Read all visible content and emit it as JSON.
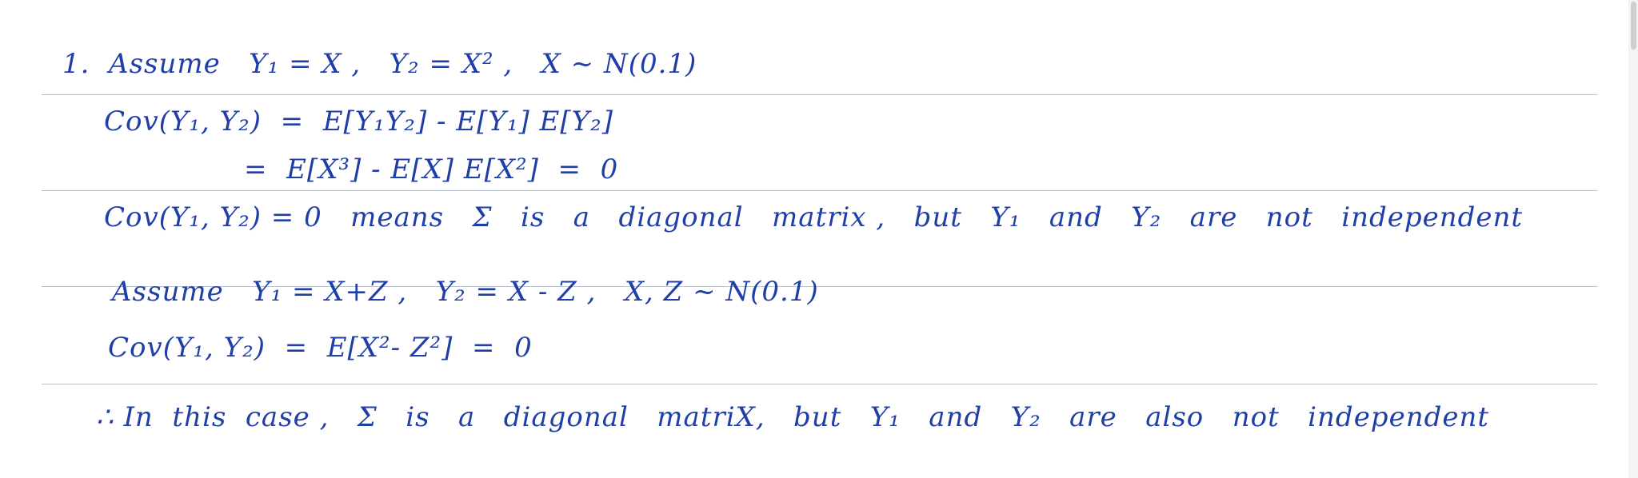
{
  "lines": {
    "l1": "1.  Assume   Y₁ = X ,   Y₂ = X² ,   X ~ N(0.1)",
    "l2": "Cov(Y₁, Y₂)  =  E[Y₁Y₂] - E[Y₁] E[Y₂]",
    "l3": "=  E[X³] - E[X] E[X²]  =  0",
    "l4": "Cov(Y₁, Y₂) = 0   means   Σ   is   a   diagonal   matrix ,   but   Y₁   and   Y₂   are   not   independent",
    "l5": "Assume   Y₁ = X+Z ,   Y₂ = X - Z ,   X, Z ~ N(0.1)",
    "l6": "Cov(Y₁, Y₂)  =  E[X²- Z²]  =  0",
    "l7": "∴ In  this  case ,   Σ   is   a   diagonal   matriX,   but   Y₁   and   Y₂   are   also   not   independent"
  }
}
